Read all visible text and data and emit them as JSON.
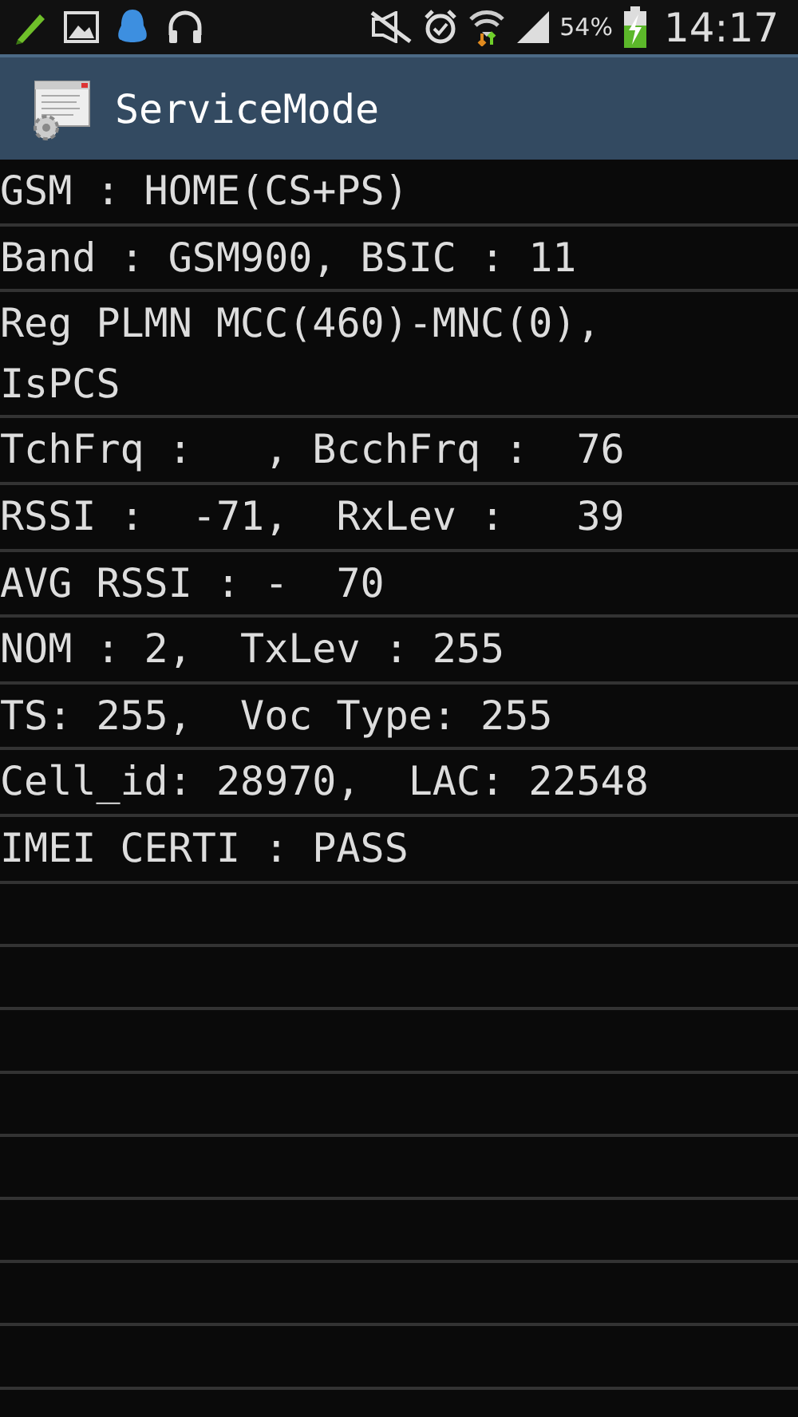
{
  "status_bar": {
    "battery_percent": "54%",
    "time": "14:17"
  },
  "app_bar": {
    "title": "ServiceMode"
  },
  "lines": [
    "GSM : HOME(CS+PS)",
    "Band : GSM900, BSIC : 11",
    "Reg PLMN MCC(460)-MNC(0), IsPCS",
    "TchFrq :   , BcchFrq :  76",
    "RSSI :  -71,  RxLev :   39",
    "AVG RSSI : -  70",
    "NOM : 2,  TxLev : 255",
    "TS: 255,  Voc Type: 255",
    "Cell_id: 28970,  LAC: 22548",
    "IMEI CERTI : PASS"
  ]
}
